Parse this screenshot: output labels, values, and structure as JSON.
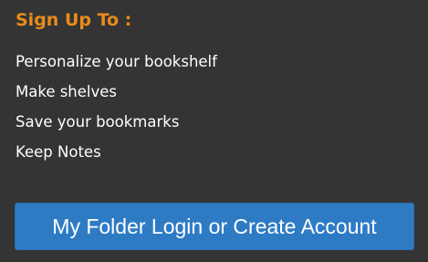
{
  "signup": {
    "title": "Sign Up To :",
    "benefits": [
      "Personalize your bookshelf",
      "Make shelves",
      "Save your bookmarks",
      "Keep Notes"
    ],
    "cta_label": "My Folder Login or Create Account"
  },
  "colors": {
    "panel_background": "#343434",
    "title_accent": "#e98b1c",
    "button_background": "#2e7bc4",
    "text": "#ffffff"
  }
}
